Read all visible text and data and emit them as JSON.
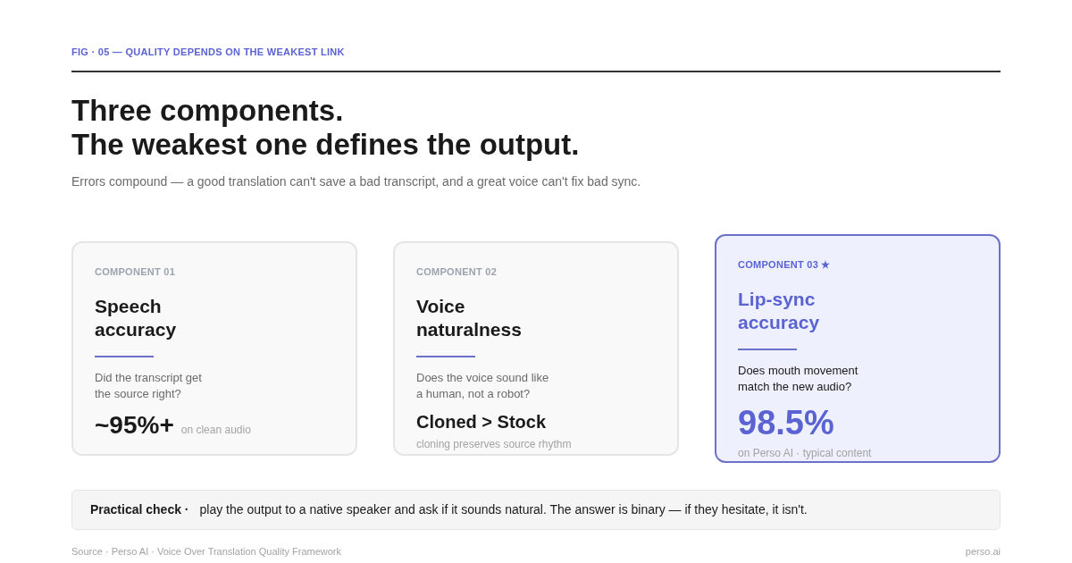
{
  "figure_label": "FIG · 05 — QUALITY DEPENDS ON THE WEAKEST LINK",
  "headline_lines": [
    "Three components.",
    "The weakest one defines the output."
  ],
  "subtitle": "Errors compound — a good translation can't save a bad transcript, and a great voice can't fix bad sync.",
  "cards": [
    {
      "eyebrow": "COMPONENT 01",
      "title_lines": [
        "Speech",
        "accuracy"
      ],
      "question_lines": [
        "Did the transcript get",
        "the source right?"
      ],
      "metric": "~95%+",
      "note": "on clean audio",
      "kind": "inline",
      "highlighted": false
    },
    {
      "eyebrow": "COMPONENT 02",
      "title_lines": [
        "Voice",
        "naturalness"
      ],
      "question_lines": [
        "Does the voice sound like",
        "a human, not a robot?"
      ],
      "metric": "Cloned > Stock",
      "note": "cloning preserves source rhythm",
      "kind": "phrase",
      "highlighted": false
    },
    {
      "eyebrow": "COMPONENT 03 ★",
      "title_lines": [
        "Lip-sync",
        "accuracy"
      ],
      "question_lines": [
        "Does mouth movement",
        "match the new audio?"
      ],
      "metric": "98.5%",
      "note": "on Perso AI · typical content",
      "kind": "hero",
      "highlighted": true
    }
  ],
  "callout": {
    "label": "Practical check ·",
    "text": "play the output to a native speaker and ask if it sounds natural. The answer is binary — if they hesitate, it isn't."
  },
  "footer": {
    "source": "Source · Perso AI · Voice Over Translation Quality Framework",
    "site": "perso.ai"
  }
}
